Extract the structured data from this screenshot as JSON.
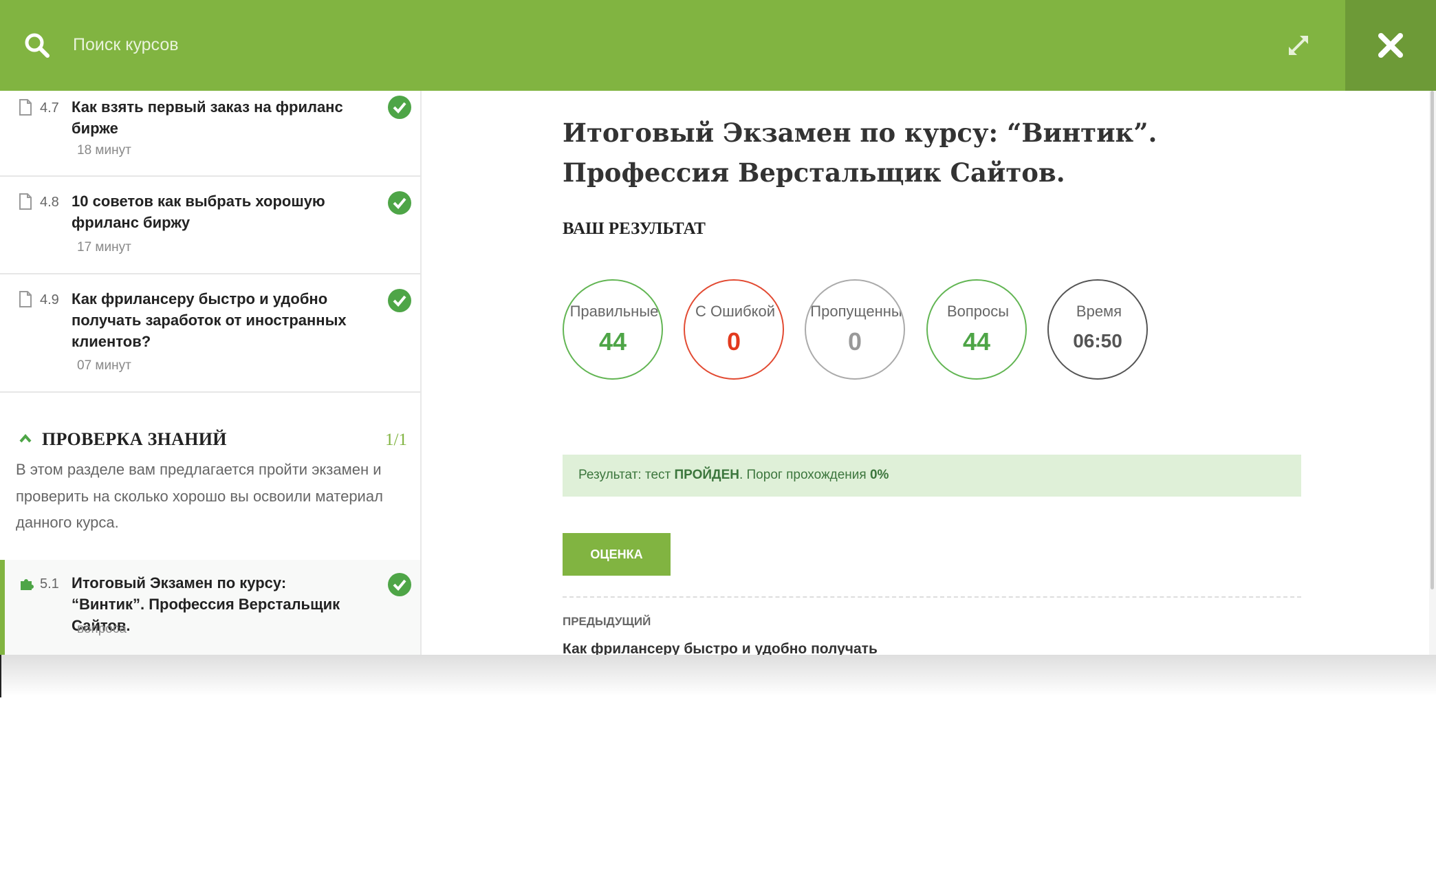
{
  "search": {
    "placeholder": "Поиск курсов"
  },
  "colors": {
    "accent": "#81b441",
    "success": "#4ea547",
    "error": "#e23a1e"
  },
  "sidebar": {
    "lessons": [
      {
        "num": "4.7",
        "title": "Как взять первый заказ на фриланс бирже",
        "meta": "18 минут",
        "icon": "document-icon",
        "completed": true
      },
      {
        "num": "4.8",
        "title": "10 советов как выбрать хорошую фриланс биржу",
        "meta": "17 минут",
        "icon": "document-icon",
        "completed": true
      },
      {
        "num": "4.9",
        "title": "Как фрилансеру быстро и удобно получать заработок от иностранных клиентов?",
        "meta": "07 минут",
        "icon": "document-icon",
        "completed": true
      }
    ],
    "section": {
      "title": "ПРОВЕРКА ЗНАНИЙ",
      "count": "1/1",
      "description": "В этом разделе вам предлагается пройти экзамен и проверить на сколько хорошо вы освоили материал данного курса."
    },
    "active_lesson": {
      "num": "5.1",
      "title": "Итоговый Экзамен по курсу: “Винтик”. Профессия Верстальщик Сайтов.",
      "meta": "вопроса",
      "icon": "puzzle-icon",
      "completed": true
    }
  },
  "main": {
    "title": "Итоговый Экзамен по курсу: “Винтик”. Профессия Верстальщик Сайтов.",
    "result_heading": "ВАШ РЕЗУЛЬТАТ",
    "stats": [
      {
        "label": "Правильные",
        "value": "44"
      },
      {
        "label": "С Ошибкой",
        "value": "0"
      },
      {
        "label": "Пропущенны",
        "value": "0"
      },
      {
        "label": "Вопросы",
        "value": "44"
      },
      {
        "label": "Время",
        "value": "06:50"
      }
    ],
    "result_bar": {
      "prefix": "Результат: тест ",
      "status": "ПРОЙДЕН",
      "middle": ". Порог прохождения ",
      "threshold": "0%"
    },
    "grade_button": "ОЦЕНКА",
    "prev_label": "ПРЕДЫДУЩИЙ",
    "prev_link": "Как фрилансеру быстро и удобно получать"
  }
}
